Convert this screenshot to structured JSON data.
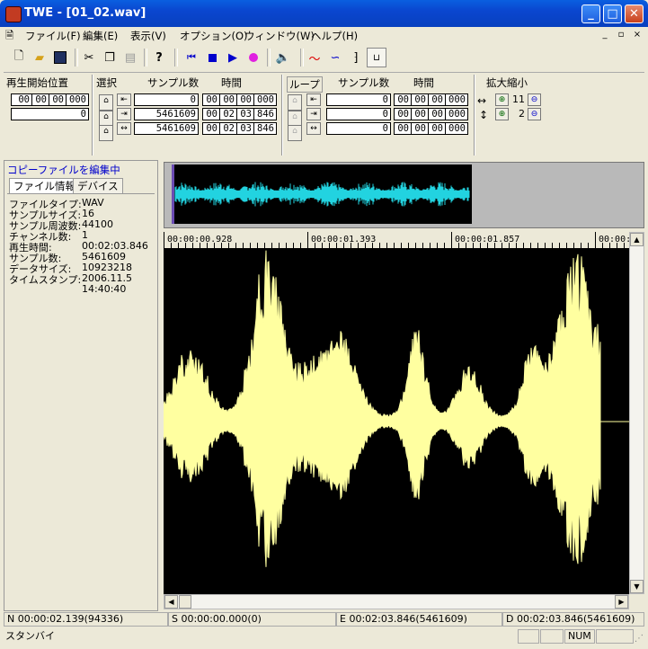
{
  "window": {
    "title": "TWE - [01_02.wav]",
    "min": "_",
    "max": "□",
    "close": "✕"
  },
  "menu": {
    "items": [
      "ファイル(F)",
      "編集(E)",
      "表示(V)",
      "オプション(O)",
      "ウィンドウ(W)",
      "ヘルプ(H)"
    ],
    "mdi": [
      "_",
      "▫",
      "×"
    ]
  },
  "playback_start": {
    "label": "再生開始位置",
    "time": [
      "00",
      "00",
      "00",
      "000"
    ],
    "samples": "0"
  },
  "selection": {
    "label": "選択",
    "samples_header": "サンプル数",
    "time_header": "時間",
    "rows": [
      {
        "samples": "0",
        "time": [
          "00",
          "00",
          "00",
          "000"
        ]
      },
      {
        "samples": "5461609",
        "time": [
          "00",
          "02",
          "03",
          "846"
        ]
      },
      {
        "samples": "5461609",
        "time": [
          "00",
          "02",
          "03",
          "846"
        ]
      }
    ]
  },
  "loop": {
    "label": "ループ",
    "samples_header": "サンプル数",
    "time_header": "時間",
    "rows": [
      {
        "samples": "0",
        "time": [
          "00",
          "00",
          "00",
          "000"
        ]
      },
      {
        "samples": "0",
        "time": [
          "00",
          "00",
          "00",
          "000"
        ]
      },
      {
        "samples": "0",
        "time": [
          "00",
          "00",
          "00",
          "000"
        ]
      }
    ]
  },
  "zoom": {
    "label": "拡大縮小",
    "horizontal": "11",
    "vertical": "2"
  },
  "left_panel": {
    "editing_label": "コピーファイルを編集中",
    "tabs": [
      "ファイル情報",
      "デバイス"
    ],
    "info": [
      {
        "key": "ファイルタイプ:",
        "value": "WAV"
      },
      {
        "key": "サンプルサイズ:",
        "value": "16"
      },
      {
        "key": "サンプル周波数:",
        "value": "44100"
      },
      {
        "key": "チャンネル数:",
        "value": "1"
      },
      {
        "key": "再生時間:",
        "value": "00:02:03.846"
      },
      {
        "key": "サンプル数:",
        "value": "5461609"
      },
      {
        "key": "データサイズ:",
        "value": "10923218"
      },
      {
        "key": "タイムスタンプ:",
        "value": "2006.11.5"
      },
      {
        "key": "",
        "value": "14:40:40"
      }
    ]
  },
  "ruler": {
    "ticks": [
      "00:00:00.928",
      "00:00:01.393",
      "00:00:01.857",
      "00:00:0"
    ]
  },
  "status": {
    "n": "N 00:00:02.139(94336)",
    "s": "S 00:00:00.000(0)",
    "e": "E 00:02:03.846(5461609)",
    "d": "D 00:02:03.846(5461609)",
    "state": "スタンバイ",
    "num": "NUM"
  },
  "colors": {
    "overview_wave": "#22D3E0",
    "main_wave": "#FFFFA0",
    "title_blue": "#0A46CF",
    "editing_text": "#0000CC"
  }
}
